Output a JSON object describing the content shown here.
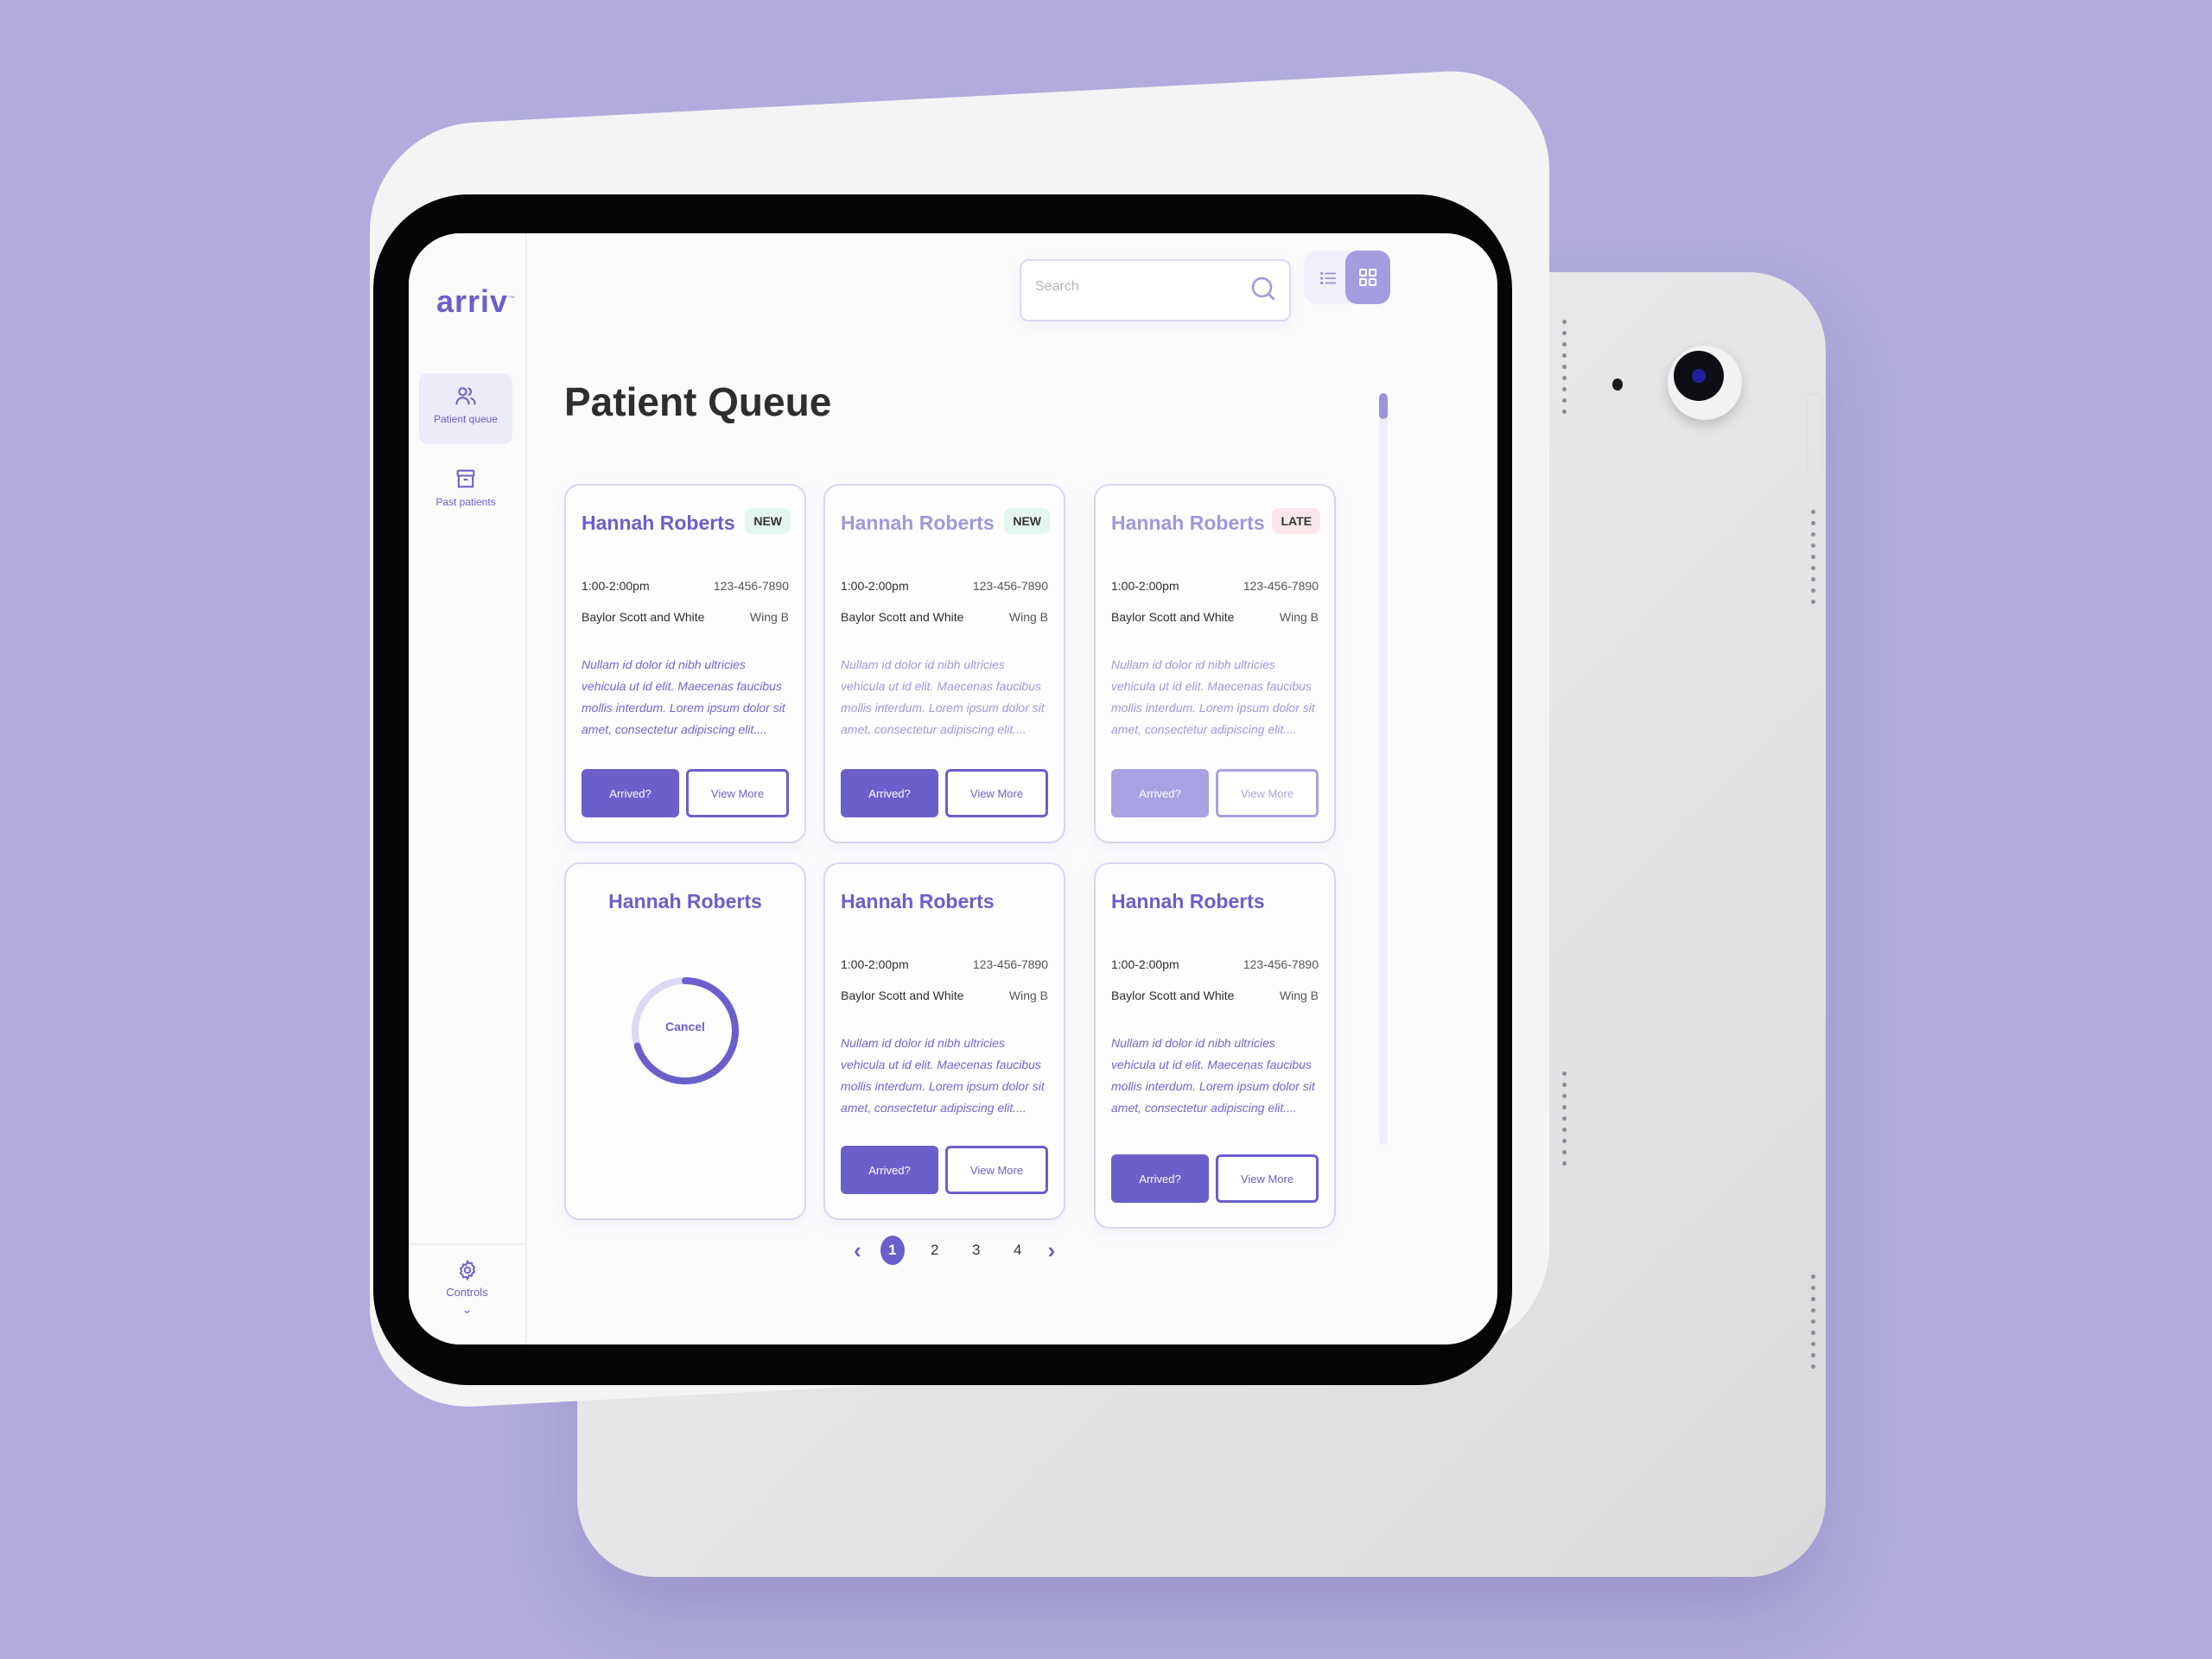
{
  "app": {
    "logo": "arriv",
    "trademark": "™"
  },
  "sidebar": {
    "items": [
      {
        "label": "Patient queue",
        "icon": "users-icon",
        "active": true
      },
      {
        "label": "Past patients",
        "icon": "archive-box-icon",
        "active": false
      }
    ],
    "footer": {
      "label": "Controls",
      "icon": "gear-icon",
      "chevron": "⌄"
    }
  },
  "header": {
    "search": {
      "placeholder": "Search",
      "value": ""
    },
    "view_toggle": {
      "options": [
        "list",
        "grid"
      ],
      "selected": "grid"
    }
  },
  "page": {
    "title": "Patient Queue"
  },
  "cards": [
    {
      "name": "Hannah Roberts",
      "badge": "NEW",
      "badge_type": "new",
      "time": "1:00-2:00pm",
      "phone": "123-456-7890",
      "hospital": "Baylor Scott and White",
      "wing": "Wing B",
      "notes": "Nullam id dolor id nibh ultricies vehicula ut id elit. Maecenas faucibus mollis interdum. Lorem ipsum dolor sit amet, consectetur adipiscing elit....",
      "primary_label": "Arrived?",
      "secondary_label": "View More"
    },
    {
      "name": "Hannah Roberts",
      "badge": "NEW",
      "badge_type": "new",
      "time": "1:00-2:00pm",
      "phone": "123-456-7890",
      "hospital": "Baylor Scott and White",
      "wing": "Wing B",
      "notes": "Nullam id dolor id nibh ultricies vehicula ut id elit. Maecenas faucibus mollis interdum. Lorem ipsum dolor sit amet, consectetur adipiscing elit....",
      "primary_label": "Arrived?",
      "secondary_label": "View More"
    },
    {
      "name": "Hannah Roberts",
      "badge": "LATE",
      "badge_type": "late",
      "time": "1:00-2:00pm",
      "phone": "123-456-7890",
      "hospital": "Baylor Scott and White",
      "wing": "Wing B",
      "notes": "Nullam id dolor id nibh ultricies vehicula ut id elit. Maecenas faucibus mollis interdum. Lorem ipsum dolor sit amet, consectetur adipiscing elit....",
      "primary_label": "Arrived?",
      "secondary_label": "View More"
    },
    {
      "name": "Hannah Roberts",
      "timer": {
        "label": "Cancel",
        "progress": 0.7
      }
    },
    {
      "name": "Hannah Roberts",
      "time": "1:00-2:00pm",
      "phone": "123-456-7890",
      "hospital": "Baylor Scott and White",
      "wing": "Wing B",
      "notes": "Nullam id dolor id nibh ultricies vehicula ut id elit. Maecenas faucibus mollis interdum. Lorem ipsum dolor sit amet, consectetur adipiscing elit....",
      "primary_label": "Arrived?",
      "secondary_label": "View More"
    },
    {
      "name": "Hannah Roberts",
      "time": "1:00-2:00pm",
      "phone": "123-456-7890",
      "hospital": "Baylor Scott and White",
      "wing": "Wing B",
      "notes": "Nullam id dolor id nibh ultricies vehicula ut id elit. Maecenas faucibus mollis interdum. Lorem ipsum dolor sit amet, consectetur adipiscing elit....",
      "primary_label": "Arrived?",
      "secondary_label": "View More"
    }
  ],
  "pagination": {
    "prev": "‹",
    "next": "›",
    "pages": [
      "1",
      "2",
      "3",
      "4"
    ],
    "current": "1"
  },
  "scroll": {
    "position": 0
  },
  "colors": {
    "accent": "#6a5fcb",
    "accent_light": "#a39de0",
    "background": "#b1acdd",
    "badge_new": "#e4f6ef",
    "badge_late": "#fbe7ea"
  }
}
